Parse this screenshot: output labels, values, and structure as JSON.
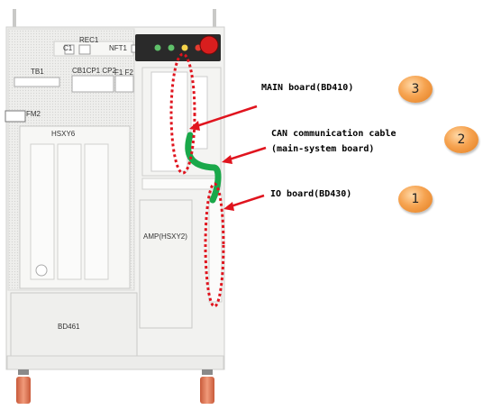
{
  "cabinet": {
    "labels": {
      "rec1": "REC1",
      "c1": "C1",
      "nft1": "NFT1",
      "tb1": "TB1",
      "cb1cp1cp2": "CB1CP1 CP2",
      "f1f2": "F1 F2",
      "fm2": "FM2",
      "hsxy6": "HSXY6",
      "amp": "AMP(HSXY2)",
      "bd461": "BD461"
    }
  },
  "callouts": [
    {
      "number": "3",
      "text": "MAIN board(BD410)"
    },
    {
      "number": "2",
      "line1": "CAN  communication  cable",
      "line2": "(main-system board)"
    },
    {
      "number": "1",
      "text": "IO board(BD430)"
    }
  ],
  "colors": {
    "highlight_dotted": "#e0141e",
    "arrow": "#e0141e",
    "cable": "#1aa84a",
    "badge": "#f29a40"
  }
}
